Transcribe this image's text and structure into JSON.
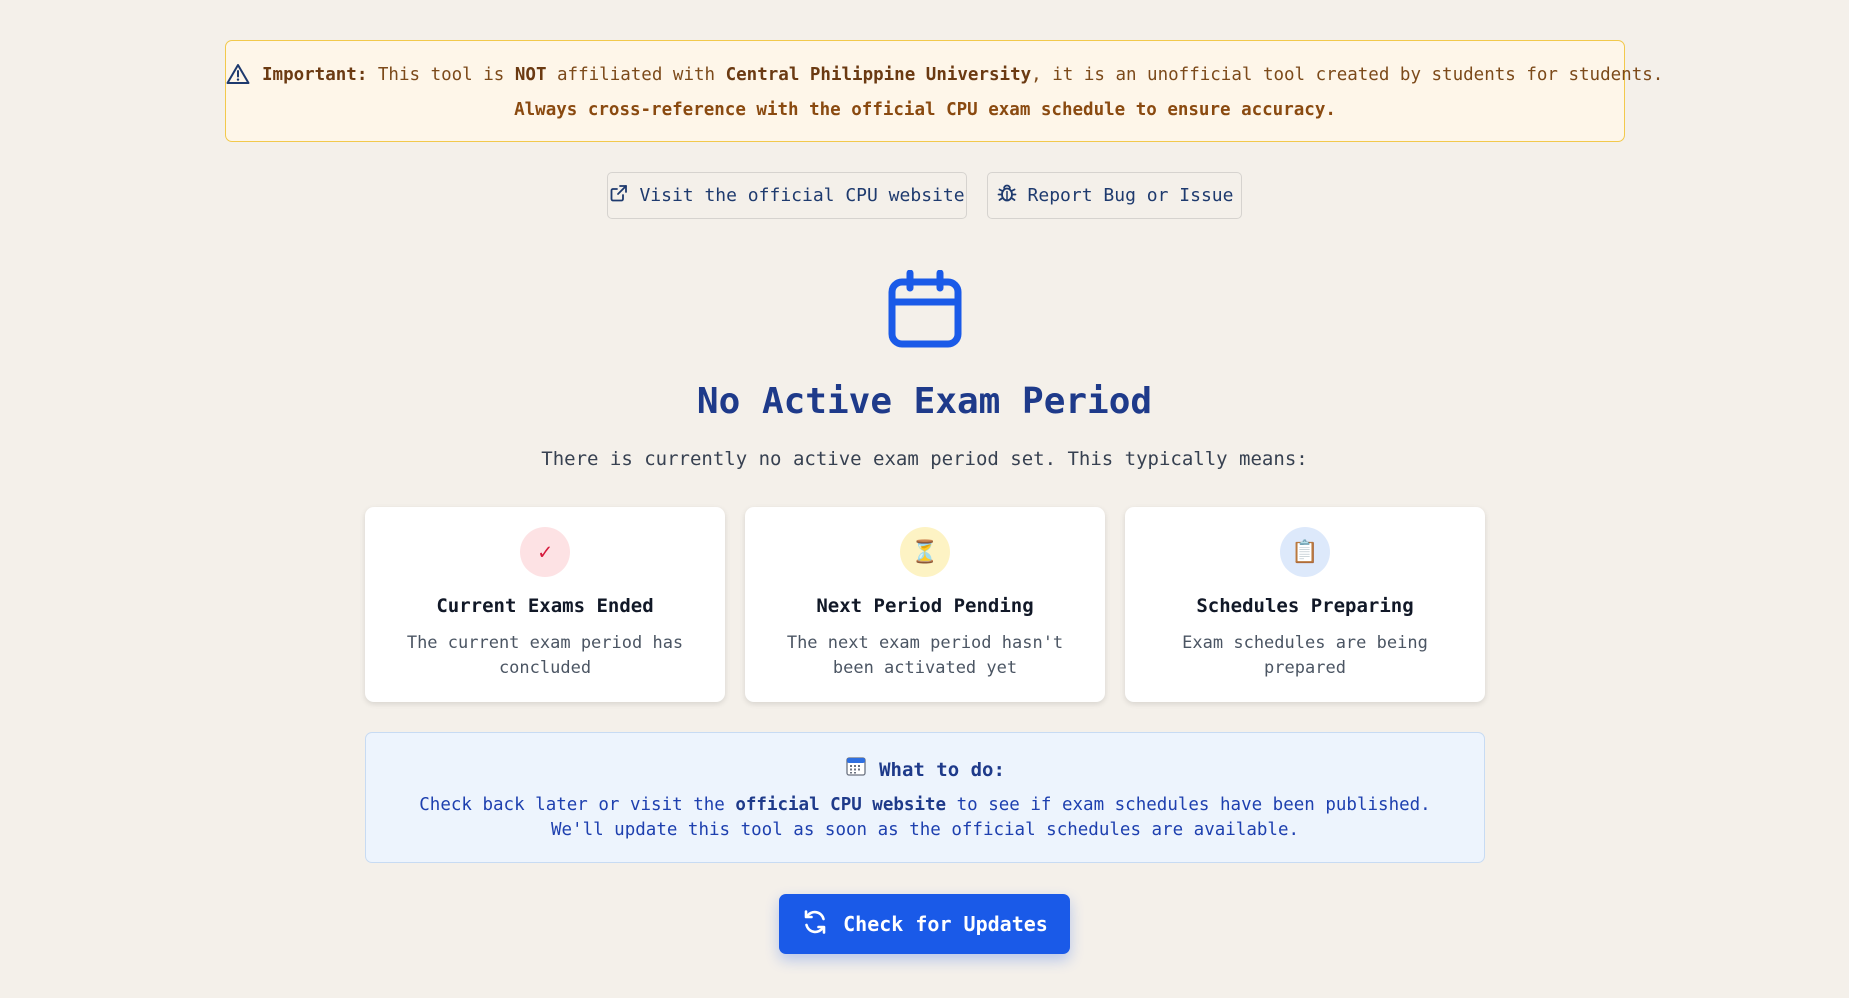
{
  "notice": {
    "label": "Important:",
    "text_1": " This tool is ",
    "not": "NOT",
    "text_2": " affiliated with ",
    "university": "Central Philippine University",
    "text_3": ", it is an unofficial tool created by students for students.",
    "line2": "Always cross-reference with the official CPU exam schedule to ensure accuracy.",
    "icon": "warning-triangle-icon"
  },
  "links": {
    "website_label": "Visit the official CPU website",
    "report_label": "Report Bug or Issue"
  },
  "hero": {
    "title": "No Active Exam Period",
    "subtitle": "There is currently no active exam period set. This typically means:"
  },
  "cards": [
    {
      "icon": "checkmark-icon",
      "glyph": "✓",
      "title": "Current Exams Ended",
      "desc": "The current exam period has concluded"
    },
    {
      "icon": "hourglass-icon",
      "glyph": "⏳",
      "title": "Next Period Pending",
      "desc": "The next exam period hasn't been activated yet"
    },
    {
      "icon": "clipboard-icon",
      "glyph": "📋",
      "title": "Schedules Preparing",
      "desc": "Exam schedules are being prepared"
    }
  ],
  "info": {
    "heading": "What to do:",
    "body_1": "Check back later or visit the ",
    "body_link": "official CPU website",
    "body_2": " to see if exam schedules have been published. We'll update this tool as soon as the official schedules are available."
  },
  "primary_button": {
    "label": "Check for Updates"
  },
  "colors": {
    "background": "#f4f0ea",
    "accent": "#1a5ae8",
    "notice_border": "#f2c94c",
    "title": "#1e3a8a"
  }
}
